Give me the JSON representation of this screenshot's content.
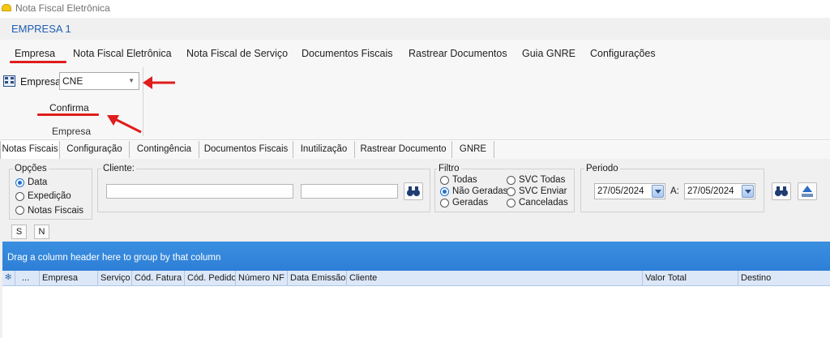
{
  "window": {
    "title": "Nota Fiscal Eletrônica"
  },
  "company": {
    "name": "EMPRESA 1"
  },
  "ribbon_tabs": [
    "Empresa",
    "Nota Fiscal Eletrônica",
    "Nota Fiscal de Serviço",
    "Documentos Fiscais",
    "Rastrear Documentos",
    "Guia GNRE",
    "Configurações"
  ],
  "ribbon": {
    "empresa_label": "Empresa",
    "empresa_value": "CNE",
    "confirm_label": "Confirma",
    "group_label": "Empresa"
  },
  "sub_tabs": [
    "Notas Fiscais",
    "Configuração",
    "Contingência",
    "Documentos Fiscais",
    "Inutilização",
    "Rastrear Documento",
    "GNRE"
  ],
  "options": {
    "title": "Opções",
    "items": [
      "Data",
      "Expedição",
      "Notas Fiscais"
    ],
    "selected": "Data"
  },
  "cliente": {
    "label": "Cliente:"
  },
  "filtro": {
    "title": "Filtro",
    "items": [
      "Todas",
      "Não Geradas",
      "Geradas",
      "SVC Todas",
      "SVC Enviar",
      "Canceladas"
    ],
    "selected": "Não Geradas"
  },
  "periodo": {
    "title": "Periodo",
    "from": "27/05/2024",
    "to_label": "A:",
    "to": "27/05/2024"
  },
  "small_buttons": [
    "S",
    "N"
  ],
  "grid": {
    "group_hint": "Drag a column header here to group by that column",
    "columns": [
      "...",
      "Empresa",
      "Serviço",
      "Cód. Fatura",
      "Cód. Pedido",
      "Número NF",
      "Data Emissão",
      "Cliente",
      "Valor Total",
      "Destino"
    ]
  },
  "colors": {
    "accent": "#2d7fd6",
    "annotation": "#e01c1c",
    "company_text": "#1f5fb3"
  },
  "icons": [
    "app-icon",
    "building-icon",
    "binoculars-icon",
    "export-icon",
    "calendar-dropdown-icon",
    "annotation-arrow"
  ]
}
